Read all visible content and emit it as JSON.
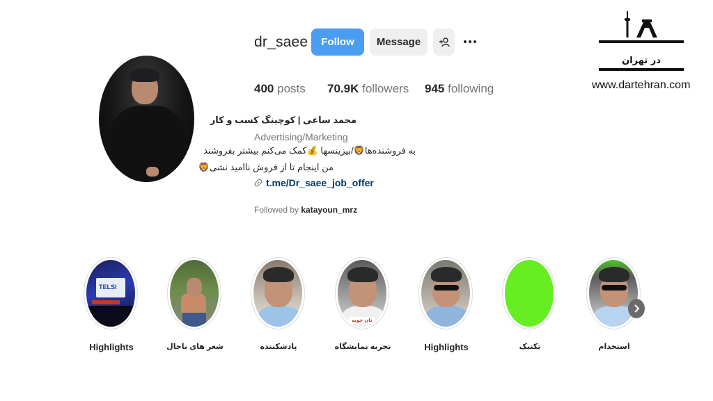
{
  "profile": {
    "username": "dr_saee",
    "follow_label": "Follow",
    "message_label": "Message",
    "posts_count": "400",
    "posts_label": "posts",
    "followers_count": "70.9K",
    "followers_label": "followers",
    "following_count": "945",
    "following_label": "following",
    "full_name": "محمد ساعی | کوچینگ کسب و کار",
    "category": "Advertising/Marketing",
    "bio_line1": "به فروشنده‌ها🦁/بیزینسها 💰کمک می‌کنم بیشتر بفروشند",
    "bio_line2": "من اینجام تا از فروش ناامید نشی🦁",
    "link": "t.me/Dr_saee_job_offer",
    "followed_by_prefix": "Followed by",
    "followed_by_user": "katayoun_mrz"
  },
  "highlights": [
    {
      "label": "Highlights",
      "screen_text": "TELSI"
    },
    {
      "label": "شعر های باحال"
    },
    {
      "label": "پادشکننده"
    },
    {
      "label": "تجربه نمایشگاه",
      "overlay_text": "ثان خوبه"
    },
    {
      "label": "Highlights"
    },
    {
      "label": "تکنیک"
    },
    {
      "label": "استخدام"
    }
  ],
  "watermark": {
    "logo_text": "در تهران",
    "site": "www.dartehran.com"
  },
  "colors": {
    "follow_button": "#4a9df0",
    "link": "#00376b",
    "green_highlight": "#66ee22"
  }
}
